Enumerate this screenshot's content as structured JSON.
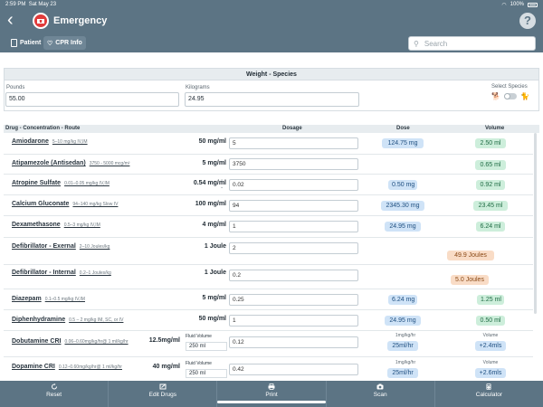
{
  "status_bar": {
    "time": "2:59 PM",
    "date": "Sat May 23",
    "battery": "100%"
  },
  "header": {
    "title": "Emergency",
    "help_label": "?"
  },
  "tabs": [
    {
      "label": "Patient"
    },
    {
      "label": "CPR Info"
    }
  ],
  "search": {
    "placeholder": "Search"
  },
  "weight": {
    "title": "Weight - Species",
    "pounds_label": "Pounds",
    "pounds_value": "55.00",
    "kilograms_label": "Kilograms",
    "kilograms_value": "24.95",
    "species_label": "Select Species"
  },
  "table_header": {
    "drug": "Drug - Concentration - Route",
    "dosage": "Dosage",
    "dose": "Dose",
    "volume": "Volume"
  },
  "drugs": [
    {
      "name": "Amiodarone",
      "range": "5–10 mg/kg IV,IM",
      "conc": "50 mg/ml",
      "dosage": "5",
      "dose": "124.75 mg",
      "volume": "2.50 ml"
    },
    {
      "name": "Atipamezole (Antisedan)",
      "range": "3750 - 5000 mcg/m²",
      "conc": "5 mg/ml",
      "dosage": "3750",
      "dose": "",
      "volume": "0.65 ml"
    },
    {
      "name": "Atropine Sulfate",
      "range": "0.01–0.05 mg/kg IV,IM",
      "conc": "0.54 mg/ml",
      "dosage": "0.02",
      "dose": "0.50 mg",
      "volume": "0.92 ml"
    },
    {
      "name": "Calcium Gluconate",
      "range": "94–140 mg/kg Slow IV",
      "conc": "100 mg/ml",
      "dosage": "94",
      "dose": "2345.30 mg",
      "volume": "23.45 ml"
    },
    {
      "name": "Dexamethasone",
      "range": "0.5–3 mg/kg IV,IM",
      "conc": "4 mg/ml",
      "dosage": "1",
      "dose": "24.95 mg",
      "volume": "6.24 ml"
    },
    {
      "name": "Defibrillator - Exernal",
      "range": "2–10 Joules/kg",
      "conc": "1 Joule",
      "dosage": "2",
      "joules": "49.9 Joules"
    },
    {
      "name": "Defibrillator - Internal",
      "range": "0.2–1 Joules/kg",
      "conc": "1 Joule",
      "dosage": "0.2",
      "joules": "5.0 Joules"
    },
    {
      "name": "Diazepam",
      "range": "0.1–0.5 mg/kg IV,IM",
      "conc": "5 mg/ml",
      "dosage": "0.25",
      "dose": "6.24 mg",
      "volume": "1.25 ml"
    },
    {
      "name": "Diphenhydramine",
      "range": "0.5 – 2 mg/kg IM, SC, or IV",
      "conc": "50 mg/ml",
      "dosage": "1",
      "dose": "24.95 mg",
      "volume": "0.50 ml"
    },
    {
      "name": "Dobutamine CRI",
      "range": "0.06–0.60mg/kg/hr@ 1 ml/kg/hr",
      "conc": "12.5mg/ml",
      "fluid_label": "Fluid Volume",
      "fluid_value": "250 ml",
      "dosage": "0.12",
      "rate_label": "1mg/kg/hr",
      "rate": "25ml/hr",
      "volume_label": "Volume",
      "volume": "+2.4mls"
    },
    {
      "name": "Dopamine CRI",
      "range": "0.12–0.60mg/kg/hr@ 1 ml/kg/hr",
      "conc": "40 mg/ml",
      "fluid_label": "Fluid Volume",
      "fluid_value": "250 ml",
      "dosage": "0.42",
      "rate_label": "1mg/kg/hr",
      "rate": "25ml/hr",
      "volume_label": "Volume",
      "volume": "+2.6mls"
    }
  ],
  "toolbar": [
    {
      "label": "Reset",
      "icon": "reset-icon"
    },
    {
      "label": "Edit Drugs",
      "icon": "edit-icon"
    },
    {
      "label": "Print",
      "icon": "print-icon"
    },
    {
      "label": "Scan",
      "icon": "camera-icon"
    },
    {
      "label": "Calculator",
      "icon": "calculator-icon"
    }
  ],
  "colors": {
    "header": "#5c7484",
    "dose_pill": "#cfe3f7",
    "volume_pill": "#cdeedb",
    "joules_pill": "#f9dcc6"
  }
}
